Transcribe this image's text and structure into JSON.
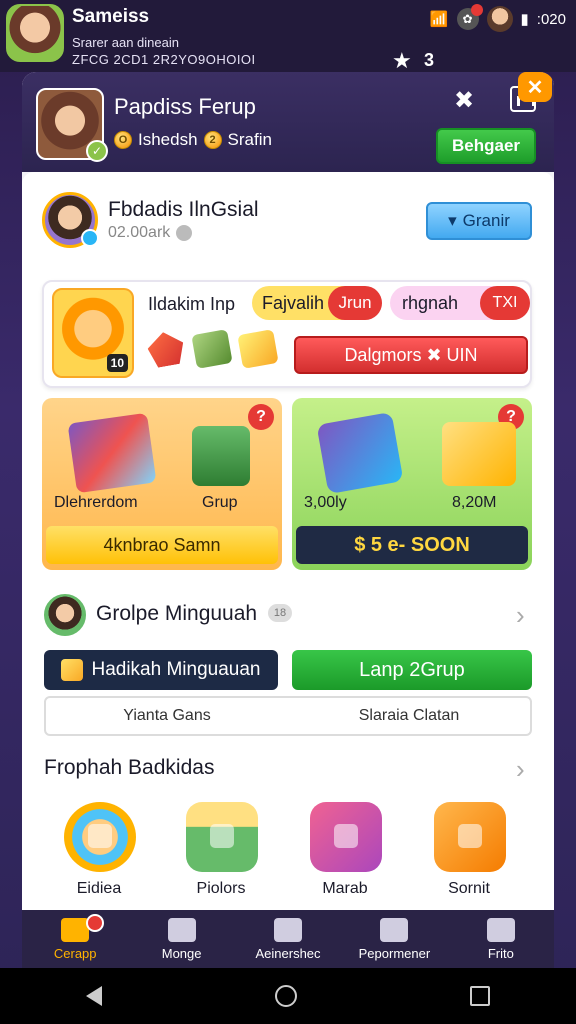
{
  "status_bar": {
    "title": "Sameiss",
    "subtitle1": "Srarer aan dineain",
    "subtitle2": "ZFCG 2CD1 2R2YO9OHOIOI",
    "time": ":020",
    "star_count": "3"
  },
  "header": {
    "title": "Papdiss Ferup",
    "currency1_icon": "O",
    "currency1_label": "Ishedsh",
    "currency2_icon": "2",
    "currency2_label": "Srafin",
    "action_button": "Behgaer",
    "close_label": "✕"
  },
  "profile": {
    "name": "Fbdadis IlnGsial",
    "meta": "02.00ark"
  },
  "blue_button": "Granir",
  "promo": {
    "title": "Ildakim Inp",
    "pill1_text": "Fajvalih",
    "pill1_badge": "Jrun",
    "pill2_text": "rhgnah",
    "pill2_badge": "TXI",
    "char_level": "10",
    "red_button": "Dalgmors ✖ UIN"
  },
  "tiles": [
    {
      "label_left": "Dlehrerdom",
      "label_right": "Grup",
      "bar_label": "4knbrao Samn",
      "badge": "?"
    },
    {
      "label_left": "3,00ly",
      "label_right": "8,20M",
      "bar_label": "$ 5 e- SOON",
      "badge": "?"
    }
  ],
  "group": {
    "title": "Grolpe Minguuah",
    "badge": "18",
    "navy_button": "Hadikah Minguauan",
    "green_button": "Lanp 2Grup",
    "tab_left": "Yianta Gans",
    "tab_right": "Slaraia Clatan"
  },
  "section2": {
    "title": "Frophah Badkidas",
    "items": [
      {
        "label": "Eidiea"
      },
      {
        "label": "Piolors"
      },
      {
        "label": "Marab"
      },
      {
        "label": "Sornit"
      }
    ]
  },
  "bottom_nav": [
    {
      "label": "Cerapp",
      "icon": "home-icon"
    },
    {
      "label": "Monge",
      "icon": "lock-icon"
    },
    {
      "label": "Aeinershec",
      "icon": "mail-icon"
    },
    {
      "label": "Pepormener",
      "icon": "inbox-icon"
    },
    {
      "label": "Frito",
      "icon": "person-icon"
    }
  ],
  "colors": {
    "accent_green": "#1e9e2b",
    "accent_red": "#d32f2f",
    "accent_blue": "#43a9f0",
    "dark_bg": "#2c2450"
  }
}
